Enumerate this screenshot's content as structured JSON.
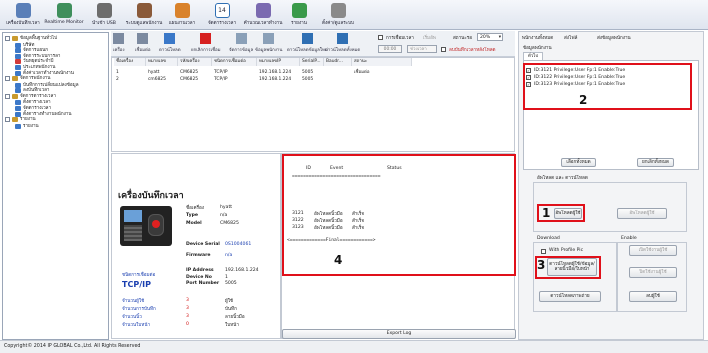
{
  "toolbar": {
    "items": [
      {
        "label": "เครื่องบันทึกเวลา",
        "color": "#5a7fb8"
      },
      {
        "label": "Realtime Monitor",
        "color": "#3f8f5c"
      },
      {
        "label": "นำเข้า USB",
        "color": "#6d6d6d"
      },
      {
        "label": "ระบบดูแลพนักงาน",
        "color": "#8a5a3a"
      },
      {
        "label": "แผนงานเวลา",
        "color": "#d9822b"
      },
      {
        "label": "จัดตารางเวลา",
        "color": "#2f6fb3"
      },
      {
        "label": "คำนวณเวลาทำงาน",
        "color": "#7a6ab0"
      },
      {
        "label": "รายงาน",
        "color": "#3a9a4a"
      },
      {
        "label": "ตั้งค่า/ดูแลระบบ",
        "color": "#8a8a8a"
      }
    ],
    "calendar_day": "14"
  },
  "tree": {
    "nodes": [
      {
        "label": "ข้อมูลพื้นฐานทั่วไป",
        "level": 0,
        "color": "#c99a2e"
      },
      {
        "label": "บริษัท",
        "level": 1,
        "color": "#3c78c8"
      },
      {
        "label": "จัดการแผนก",
        "level": 1,
        "color": "#3c78c8"
      },
      {
        "label": "จัดการระบบการลา",
        "level": 1,
        "color": "#3c78c8"
      },
      {
        "label": "วันหยุดประจำปี",
        "level": 1,
        "color": "#d23a3a"
      },
      {
        "label": "ประเภทพนักงาน",
        "level": 1,
        "color": "#3c78c8"
      },
      {
        "label": "ตั้งค่าเวลาทำงานพนักงาน",
        "level": 1,
        "color": "#3c78c8"
      },
      {
        "label": "จัดการพนักงาน",
        "level": 0,
        "color": "#c99a2e"
      },
      {
        "label": "บันทึกการเปลี่ยนแปลงข้อมูล",
        "level": 1,
        "color": "#3c78c8"
      },
      {
        "label": "ลงบันทึกเวลา",
        "level": 1,
        "color": "#3c78c8"
      },
      {
        "label": "จัดการตารางเวลา",
        "level": 0,
        "color": "#c99a2e"
      },
      {
        "label": "ตั้งตารางเวลา",
        "level": 1,
        "color": "#3c78c8"
      },
      {
        "label": "จัดตารางเวลา",
        "level": 1,
        "color": "#3c78c8"
      },
      {
        "label": "ตั้งตารางทำงานพนักงาน",
        "level": 1,
        "color": "#3c78c8"
      },
      {
        "label": "รายงาน",
        "level": 0,
        "color": "#c99a2e"
      },
      {
        "label": "รายงาน",
        "level": 1,
        "color": "#3c78c8"
      }
    ]
  },
  "device_toolbar": {
    "buttons": [
      "เครื่อง",
      "เชื่อมต่อ",
      "ดาวน์โหลด",
      "ยกเลิกการเชื่อม",
      "จัดการข้อมูล",
      "ข้อมูลพนักงาน",
      "ดาวน์โหลดข้อมูลใหม่",
      "ดาวน์โหลดทั้งหมด"
    ],
    "checkbox1": "การเชื่อมเวลา",
    "checkbox2": "ลบบันทึกเวลาหลังโหลด",
    "time_value": "00:00",
    "time_placeholder": "ช่วงเวลา",
    "refresh_label": "เริ่มอัพ",
    "status_label": "สถานะรอ",
    "percent": "20%"
  },
  "devices": {
    "headers": [
      "ชื่อเครื่อง",
      "หมายเลข",
      "รหัสเครื่อง",
      "ชนิดการเชื่อมต่อ",
      "หมายเลขIP",
      "SerialP...",
      "Baudr...",
      "สถานะ"
    ],
    "rows": [
      [
        "1",
        "hyatt",
        "CM6825",
        "TCP/IP",
        "192.168.1.224",
        "5005",
        "",
        "เชื่อมต่อ"
      ],
      [
        "2",
        "cm6825",
        "CM6825",
        "TCP/IP",
        "192.168.1.224",
        "5005",
        "",
        ""
      ]
    ]
  },
  "detail": {
    "title": "เครื่องบันทึกเวลา",
    "fields": [
      {
        "k": "ชื่อเครื่อง",
        "v": "hyatt"
      },
      {
        "k": "Type",
        "v": "n/a"
      },
      {
        "k": "Model",
        "v": "CM6825"
      }
    ],
    "serial_label": "Device Serial",
    "serial_value": "0S1004061",
    "firmware_label": "Firmware",
    "firmware_value": "n/a",
    "conn_label": "ชนิดการเชื่อมต่อ",
    "conn_value": "TCP/IP",
    "net": [
      {
        "k": "IP Address",
        "v": "192.168.1.224"
      },
      {
        "k": "Device No",
        "v": "1"
      },
      {
        "k": "Port Number",
        "v": "5005"
      }
    ],
    "stats": [
      {
        "k": "จำนวนผู้ใช้",
        "n": "3",
        "u": "ผู้ใช้"
      },
      {
        "k": "จำนวนการบันทึก",
        "n": "3",
        "u": "บันทึก"
      },
      {
        "k": "จำนวนนิ้ว",
        "n": "3",
        "u": "ลายนิ้วมือ"
      },
      {
        "k": "จำนวนใบหน้า",
        "n": "0",
        "u": "ใบหน้า"
      }
    ]
  },
  "log": {
    "headers": [
      "ID",
      "Event",
      "Status"
    ],
    "divider": "================================",
    "rows": [
      {
        "id": "3121",
        "event": "อัพโหลดนิ้วมือ",
        "status": "สำเร็จ"
      },
      {
        "id": "3122",
        "event": "อัพโหลดนิ้วมือ",
        "status": "สำเร็จ"
      },
      {
        "id": "3123",
        "event": "อัพโหลดนิ้วมือ",
        "status": "สำเร็จ"
      }
    ],
    "final": "<=============Final============>",
    "export_label": "Export Log"
  },
  "right_panel": {
    "tabs": [
      "พนักงานทั้งหมด",
      "ส่งไฟล์",
      "ส่งข้อมูลพนักงาน"
    ],
    "group_label": "ข้อมูลพนักงาน",
    "subtab": "ทั่วไป",
    "checks": [
      "ID:3121 Privilege:User Fp:1 Enable:True",
      "ID:3122 Privilege:User Fp:1 Enable:True",
      "ID:3123 Privilege:User Fp:1 Enable:True"
    ],
    "select_all": "เลือกทั้งหมด",
    "deselect_all": "ยกเลิกทั้งหมด",
    "upload_group": "อัพโหลด และ ดาวน์โหลด",
    "upload_user": "อัพโหลดผู้ใช้",
    "upload_user2": "อัพโหลดผู้ใช้",
    "download_group": "Download",
    "with_profile": "With Profile Pic",
    "download_user": "ดาวน์โหลดผู้ใช้/ข้อมูล/ลายนิ้วมือ/ใบหน้า",
    "download_face": "ดาวน์โหลดภาพถ่าย",
    "enable_group": "Enable",
    "enable_user": "เปิดใช้งานผู้ใช้",
    "disable_user": "ปิดใช้งานผู้ใช้",
    "delete_user": "ลบผู้ใช้"
  },
  "annotations": {
    "n1": "1",
    "n2": "2",
    "n3": "3",
    "n4": "4"
  },
  "status_bar": "Copyright© 2014 IP GLOBAL Co.,Ltd. All Rights Reserved"
}
